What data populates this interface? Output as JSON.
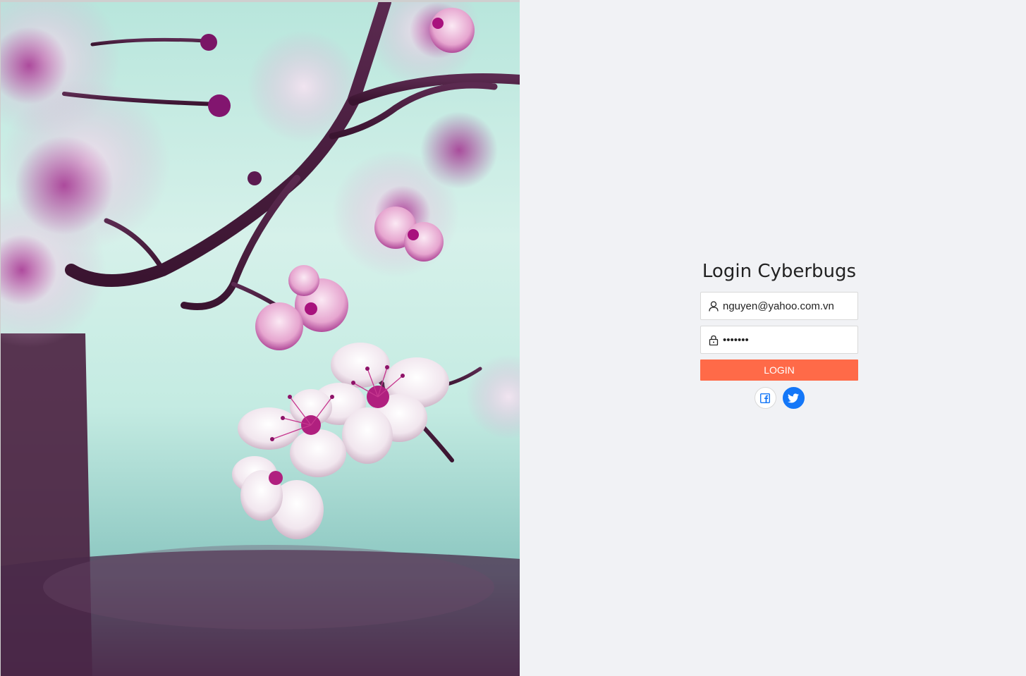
{
  "login": {
    "title": "Login Cyberbugs",
    "email_value": "nguyen@yahoo.com.vn",
    "password_value": "•••••••",
    "login_label": "LOGIN"
  },
  "social": {
    "facebook_icon": "facebook-icon",
    "twitter_icon": "twitter-icon"
  },
  "colors": {
    "login_button": "#ff6a48",
    "twitter_button": "#1477f8",
    "facebook_icon": "#1477f8",
    "page_background": "#f1f2f5"
  }
}
